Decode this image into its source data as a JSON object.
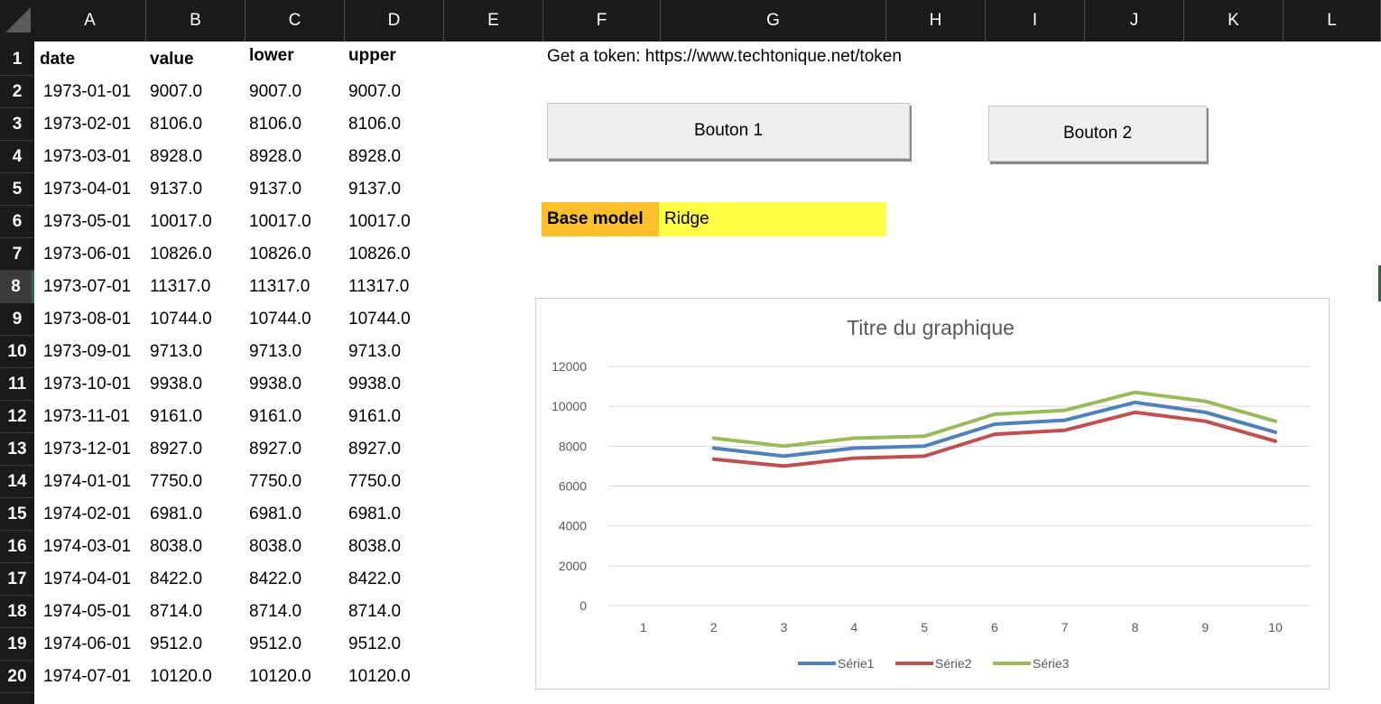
{
  "columns": [
    "A",
    "B",
    "C",
    "D",
    "E",
    "F",
    "G",
    "H",
    "I",
    "J",
    "K",
    "L"
  ],
  "rows": [
    "1",
    "2",
    "3",
    "4",
    "5",
    "6",
    "7",
    "8",
    "9",
    "10",
    "11",
    "12",
    "13",
    "14",
    "15",
    "16",
    "17",
    "18",
    "19",
    "20"
  ],
  "active_row": "8",
  "table": {
    "headers": [
      "date",
      "value",
      "lower",
      "upper"
    ],
    "records": [
      [
        "1973-01-01",
        "9007.0",
        "9007.0",
        "9007.0"
      ],
      [
        "1973-02-01",
        "8106.0",
        "8106.0",
        "8106.0"
      ],
      [
        "1973-03-01",
        "8928.0",
        "8928.0",
        "8928.0"
      ],
      [
        "1973-04-01",
        "9137.0",
        "9137.0",
        "9137.0"
      ],
      [
        "1973-05-01",
        "10017.0",
        "10017.0",
        "10017.0"
      ],
      [
        "1973-06-01",
        "10826.0",
        "10826.0",
        "10826.0"
      ],
      [
        "1973-07-01",
        "11317.0",
        "11317.0",
        "11317.0"
      ],
      [
        "1973-08-01",
        "10744.0",
        "10744.0",
        "10744.0"
      ],
      [
        "1973-09-01",
        "9713.0",
        "9713.0",
        "9713.0"
      ],
      [
        "1973-10-01",
        "9938.0",
        "9938.0",
        "9938.0"
      ],
      [
        "1973-11-01",
        "9161.0",
        "9161.0",
        "9161.0"
      ],
      [
        "1973-12-01",
        "8927.0",
        "8927.0",
        "8927.0"
      ],
      [
        "1974-01-01",
        "7750.0",
        "7750.0",
        "7750.0"
      ],
      [
        "1974-02-01",
        "6981.0",
        "6981.0",
        "6981.0"
      ],
      [
        "1974-03-01",
        "8038.0",
        "8038.0",
        "8038.0"
      ],
      [
        "1974-04-01",
        "8422.0",
        "8422.0",
        "8422.0"
      ],
      [
        "1974-05-01",
        "8714.0",
        "8714.0",
        "8714.0"
      ],
      [
        "1974-06-01",
        "9512.0",
        "9512.0",
        "9512.0"
      ],
      [
        "1974-07-01",
        "10120.0",
        "10120.0",
        "10120.0"
      ]
    ]
  },
  "token_text": "Get a token: https://www.techtonique.net/token",
  "buttons": {
    "button1_label": "Bouton 1",
    "button2_label": "Bouton 2"
  },
  "base_model": {
    "label": "Base model",
    "value": "Ridge"
  },
  "colors": {
    "base_model_label_bg": "#fbbf2d",
    "base_model_value_bg": "#ffff44",
    "series1": "#4f81bd",
    "series2": "#c0504d",
    "series3": "#9bbb59"
  },
  "chart_data": {
    "type": "line",
    "title": "Titre du graphique",
    "xlabel": "",
    "ylabel": "",
    "categories": [
      "1",
      "2",
      "3",
      "4",
      "5",
      "6",
      "7",
      "8",
      "9",
      "10"
    ],
    "yticks": [
      "0",
      "2000",
      "4000",
      "6000",
      "8000",
      "10000",
      "12000"
    ],
    "ylim": [
      0,
      12000
    ],
    "grid": true,
    "legend_position": "bottom",
    "series": [
      {
        "name": "Série1",
        "values": [
          null,
          7900,
          7500,
          7900,
          8000,
          9100,
          9300,
          10200,
          9700,
          8700
        ]
      },
      {
        "name": "Série2",
        "values": [
          null,
          7350,
          7000,
          7400,
          7500,
          8600,
          8800,
          9700,
          9250,
          8250
        ]
      },
      {
        "name": "Série3",
        "values": [
          null,
          8400,
          8000,
          8400,
          8500,
          9600,
          9800,
          10700,
          10250,
          9250
        ]
      }
    ]
  }
}
